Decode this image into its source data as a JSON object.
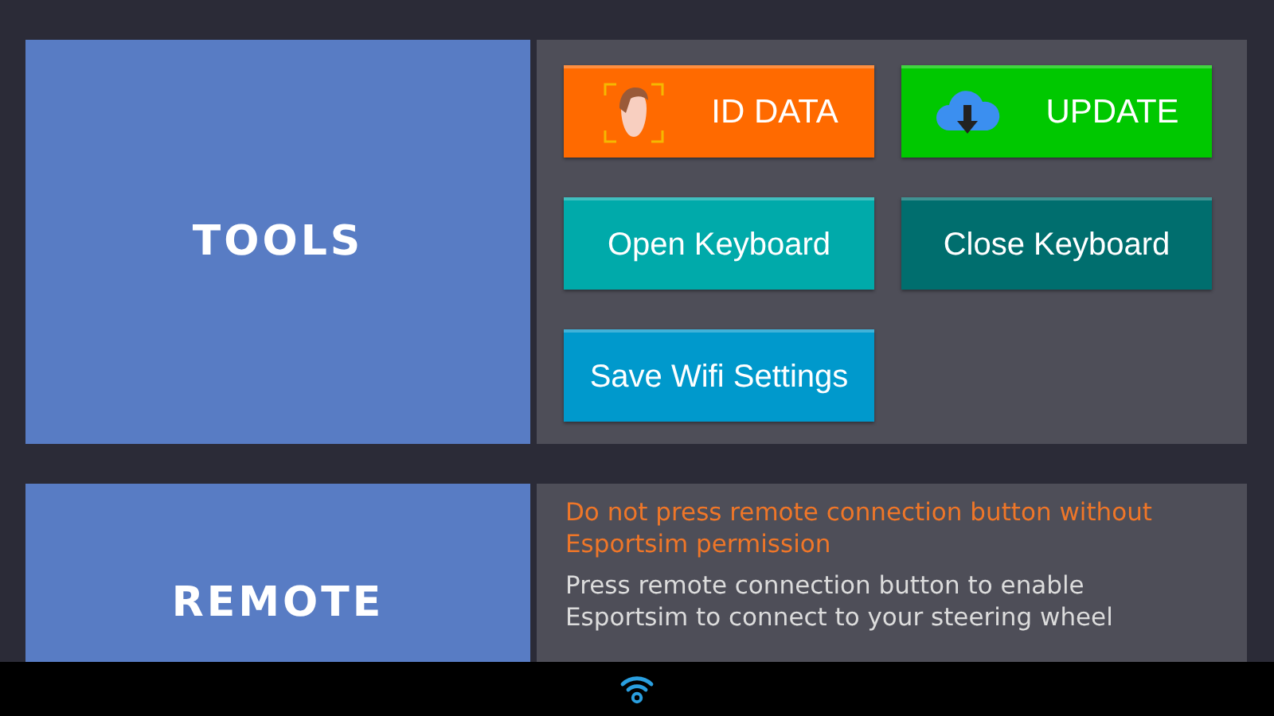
{
  "tools": {
    "title": "TOOLS",
    "buttons": [
      {
        "label": "ID DATA",
        "kind": "id",
        "color": "#ff6a00"
      },
      {
        "label": "UPDATE",
        "kind": "update",
        "color": "#00c800"
      },
      {
        "label": "Open Keyboard",
        "kind": "text",
        "color": "#00aaaa"
      },
      {
        "label": "Close Keyboard",
        "kind": "text",
        "color": "#006e6e"
      },
      {
        "label": "Save Wifi Settings",
        "kind": "text",
        "color": "#0099cc"
      }
    ]
  },
  "remote": {
    "title": "REMOTE",
    "warning": "Do not press remote connection button without Esportsim permission",
    "info": "Press remote connection button to enable Esportsim to connect to your steering wheel"
  }
}
